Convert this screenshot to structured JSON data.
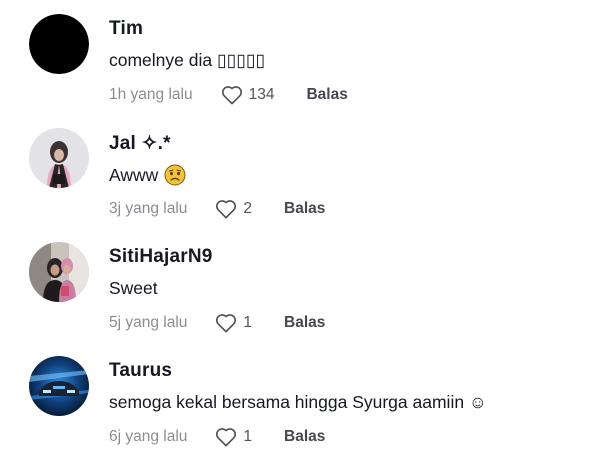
{
  "comments": [
    {
      "username": "Tim",
      "text": "comelnye dia ▯▯▯▯▯",
      "time": "1h yang lalu",
      "likes": "134",
      "reply": "Balas",
      "avatar_icon": "avatar-black-circle"
    },
    {
      "username": "Jal ✧.*",
      "text": "Awww",
      "text_emoji": "sad-face-emoji",
      "time": "3j yang lalu",
      "likes": "2",
      "reply": "Balas",
      "avatar_icon": "avatar-girl-hijab"
    },
    {
      "username": "SitiHajarN9",
      "text": "Sweet",
      "time": "5j yang lalu",
      "likes": "1",
      "reply": "Balas",
      "avatar_icon": "avatar-couple-photo"
    },
    {
      "username": "Taurus",
      "text": "semoga kekal bersama hingga Syurga aamiin ☺",
      "time": "6j yang lalu",
      "likes": "1",
      "reply": "Balas",
      "avatar_icon": "avatar-blue-car"
    }
  ],
  "colors": {
    "text_primary": "#161823",
    "text_secondary": "#8a8b91",
    "background": "#ffffff"
  }
}
